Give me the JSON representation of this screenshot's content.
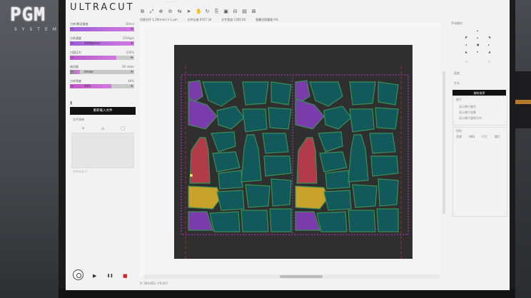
{
  "logo": {
    "main": "PGM",
    "sub": "SYSTEM"
  },
  "app": {
    "brand": "ULTRACUT",
    "window_title": "··· ··· ···"
  },
  "toolbar": {
    "icons": [
      "⧉",
      "⤢",
      "⊕",
      "⊖",
      "⇆",
      "➤",
      "✋",
      "↻",
      "⎘",
      "▣",
      "⊟",
      "▤",
      "⊠"
    ]
  },
  "info_bar": [
    "切割文件 1.29(mm) 1:1 μm",
    "文件长度 6557.34",
    "文件宽度 1385.00",
    "重叠切割重量 0%"
  ],
  "left_panel": {
    "params": [
      {
        "label": "刀补/移动速度",
        "value": "30m/s",
        "inner": "",
        "fill_percent": 100,
        "color": "#9a5fd8"
      },
      {
        "label": "刀补速度",
        "value": "2500g/s",
        "inner": "2500g/mm",
        "fill_percent": 100,
        "color": "#9a5fd8"
      },
      {
        "label": "刀盘压力",
        "value": "100%",
        "inner": "",
        "fill_percent": 72,
        "color": "#b557c8"
      },
      {
        "label": "吸风量",
        "value": "60 mbar",
        "inner": "0mbar",
        "fill_percent": 16,
        "color": "#8a8a8a"
      },
      {
        "label": "刀补角度",
        "value": "48%",
        "inner": "48%",
        "fill_percent": 64,
        "color": "#c155c6"
      }
    ],
    "reload_button": "重新载入文件",
    "file_list_label": "文件清单",
    "file_count": "文件共计 0"
  },
  "controls": {
    "play": "▶",
    "pause": "❚❚",
    "stop": "■"
  },
  "status": "X: 560.852, Y:0.937",
  "right_panel": {
    "title": "手动操作",
    "speed_label": "速度",
    "step_label": "步长",
    "sort_button": "按料排序",
    "section1": "裁片",
    "checks": [
      "显示裁片编号",
      "显示裁片轮廓",
      "显示裁片旋转方向"
    ],
    "section2": "排料",
    "tabs": [
      "全部",
      "材料",
      "尺寸",
      "裁片"
    ]
  },
  "colors": {
    "sheet": "#2f2f2f",
    "teal": "#11595b",
    "purple": "#7a3cab",
    "red": "#b23b4a",
    "yellow": "#c9a22b",
    "outline": "#3a8f56"
  }
}
